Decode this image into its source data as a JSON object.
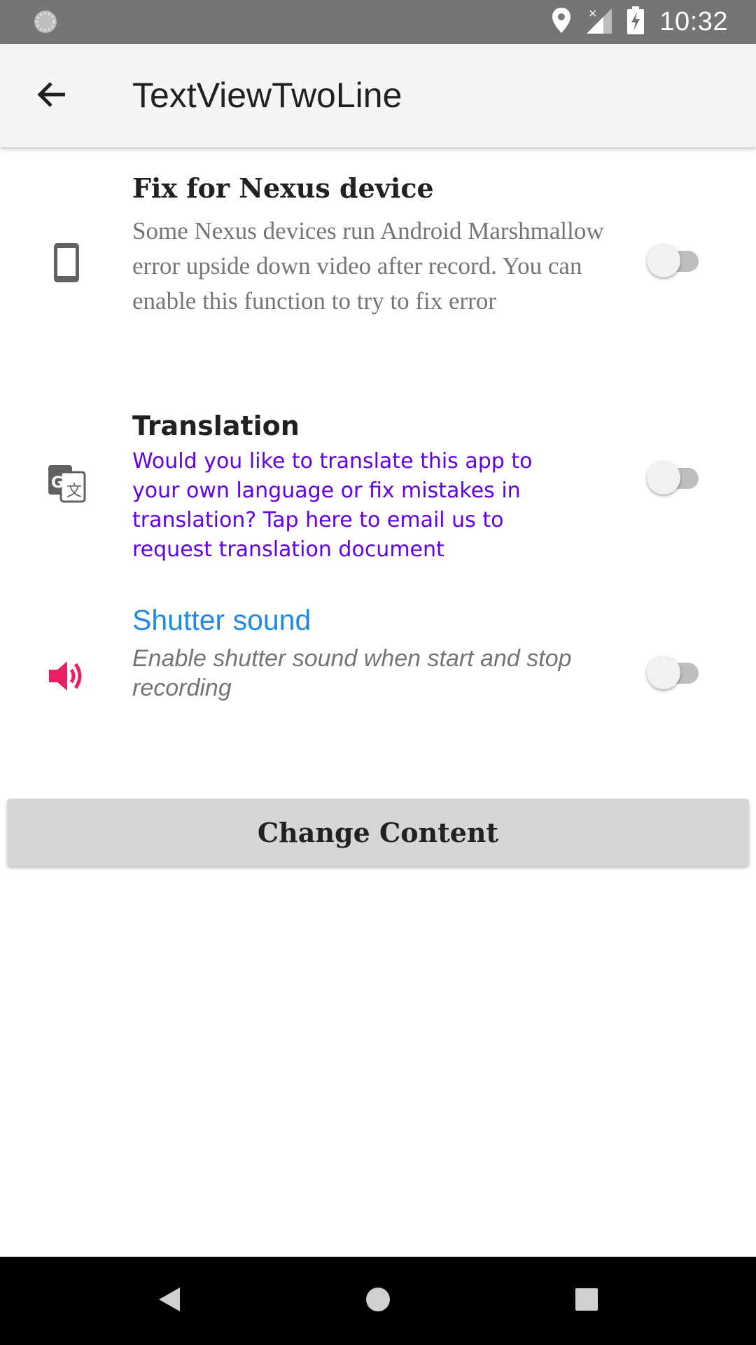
{
  "status_bar": {
    "time": "10:32",
    "icons": [
      "loading-icon",
      "location-icon",
      "no-signal-icon",
      "battery-charging-icon"
    ]
  },
  "app_bar": {
    "title": "TextViewTwoLine",
    "back_icon": "arrow-back-icon"
  },
  "settings": [
    {
      "icon": "phone-icon",
      "title": "Fix for Nexus device",
      "description": "Some Nexus devices run Android Marshmallow error upside down video after record. You can enable this function to try to fix error",
      "enabled": false
    },
    {
      "icon": "translate-icon",
      "title": "Translation",
      "description": "Would you like to translate this app to your own language or fix mistakes in translation? Tap here to email us to request translation document",
      "enabled": false
    },
    {
      "icon": "volume-icon",
      "title": "Shutter sound",
      "description": "Enable shutter sound when start and stop recording",
      "enabled": false
    }
  ],
  "change_button": {
    "label": "Change Content"
  },
  "nav_bar": {
    "buttons": [
      "back-triangle-icon",
      "home-circle-icon",
      "recents-square-icon"
    ]
  },
  "colors": {
    "status_bar": "#757575",
    "app_bar": "#f5f5f5",
    "translation_desc": "#6200ea",
    "shutter_title": "#1e88e5",
    "volume_icon": "#e91e63"
  }
}
